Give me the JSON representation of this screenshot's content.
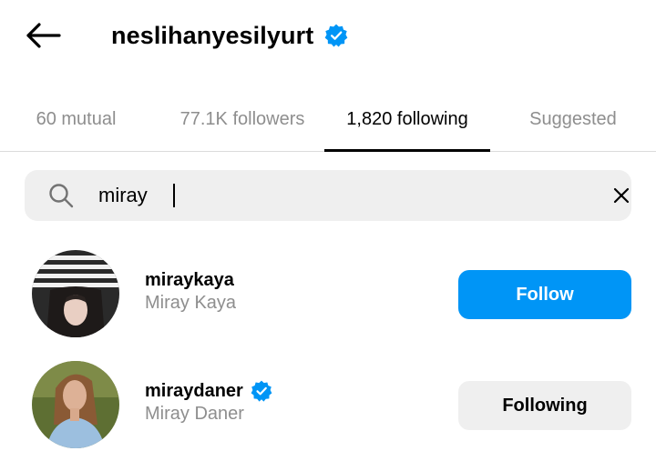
{
  "header": {
    "title": "neslihanyesilyurt",
    "back_icon": "arrow-left-icon",
    "verified_icon": "verified-badge-icon",
    "verified_color": "#0095f6"
  },
  "tabs": [
    {
      "label": "60 mutual",
      "active": false
    },
    {
      "label": "77.1K followers",
      "active": false
    },
    {
      "label": "1,820 following",
      "active": true
    },
    {
      "label": "Suggested",
      "active": false
    }
  ],
  "search": {
    "value": "miray",
    "search_icon": "search-icon",
    "clear_icon": "close-icon"
  },
  "results": [
    {
      "handle": "miraykaya",
      "name": "Miray Kaya",
      "verified": false,
      "button": "Follow",
      "button_style": "primary"
    },
    {
      "handle": "miraydaner",
      "name": "Miray Daner",
      "verified": true,
      "button": "Following",
      "button_style": "secondary"
    }
  ],
  "colors": {
    "primary": "#0095f6",
    "muted_text": "#8e8e8e",
    "secondary_bg": "#efefef"
  }
}
